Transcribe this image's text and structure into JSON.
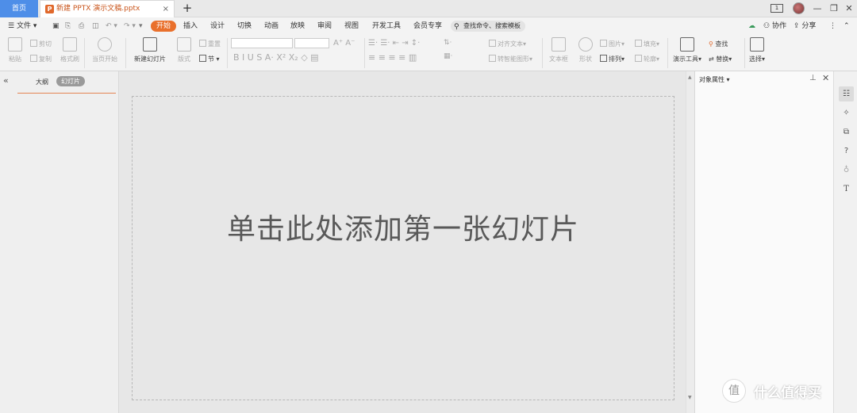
{
  "tabs": {
    "home": "首页",
    "document": "新建 PPTX 演示文稿.pptx",
    "add": "+"
  },
  "window": {
    "badge": "1",
    "minimize": "—",
    "restore": "❐",
    "close": "✕"
  },
  "menu": {
    "file": "文件",
    "items": [
      "开始",
      "插入",
      "设计",
      "切换",
      "动画",
      "放映",
      "审阅",
      "视图",
      "开发工具",
      "会员专享"
    ],
    "active": "开始",
    "search_placeholder": "查找命令、搜索模板",
    "collab": "协作",
    "share": "分享"
  },
  "ribbon": {
    "paste": "粘贴",
    "cut": "剪切",
    "copy": "复制",
    "format_painter": "格式刷",
    "start_from_current": "当页开始",
    "new_slide": "新建幻灯片",
    "layout": "版式",
    "reset": "重置",
    "section": "节",
    "align_text": "对齐文本",
    "convert_smartart": "转智能图形",
    "textbox": "文本框",
    "shape": "形状",
    "picture": "图片",
    "arrange": "排列",
    "fill": "填充",
    "outline": "轮廓",
    "presentation_tools": "演示工具",
    "find": "查找",
    "replace": "替换",
    "select": "选择"
  },
  "left_panel": {
    "outline_tab": "大纲",
    "slides_tab": "幻灯片"
  },
  "canvas": {
    "placeholder": "单击此处添加第一张幻灯片"
  },
  "right_panel": {
    "title": "对象属性"
  },
  "watermark": {
    "text": "什么值得买",
    "logo": "值"
  },
  "colors": {
    "accent": "#e9702c",
    "home_tab": "#4e8ee8"
  }
}
